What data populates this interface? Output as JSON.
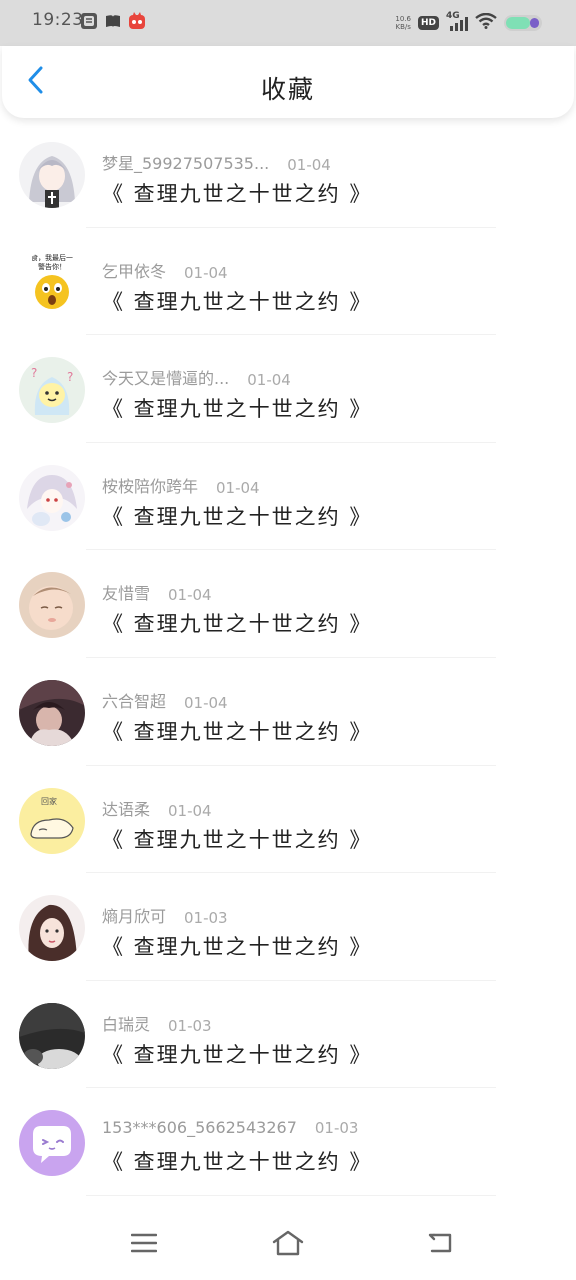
{
  "status_bar": {
    "time": "19:23",
    "net_speed_value": "10.6",
    "net_speed_unit": "KB/s",
    "hd_label": "HD",
    "network_label": "4G",
    "notification_icons": [
      "app-icon-box",
      "book-icon",
      "fox-app-icon"
    ],
    "battery_level": 0.6
  },
  "header": {
    "title": "收藏",
    "back_icon": "chevron-left-icon",
    "accent_color": "#1f8ee8"
  },
  "favorites": [
    {
      "name": "梦星_59927507535...",
      "date": "01-04",
      "content": "《 查理九世之十世之约 》"
    },
    {
      "name": "乞甲依冬",
      "date": "01-04",
      "content": "《 查理九世之十世之约 》"
    },
    {
      "name": "今天又是懵逼的...",
      "date": "01-04",
      "content": "《 查理九世之十世之约 》"
    },
    {
      "name": "桉桉陪你跨年",
      "date": "01-04",
      "content": "《 查理九世之十世之约 》"
    },
    {
      "name": "友惜雪",
      "date": "01-04",
      "content": "《 查理九世之十世之约 》"
    },
    {
      "name": "六合智超",
      "date": "01-04",
      "content": "《 查理九世之十世之约 》"
    },
    {
      "name": "达语柔",
      "date": "01-04",
      "content": "《 查理九世之十世之约 》"
    },
    {
      "name": "熵月欣可",
      "date": "01-03",
      "content": "《 查理九世之十世之约 》"
    },
    {
      "name": "白瑞灵",
      "date": "01-03",
      "content": "《 查理九世之十世之约 》"
    },
    {
      "name": "153***606_5662543267",
      "date": "01-03",
      "content": "《 查理九世之十世之约 》"
    }
  ],
  "avatar_texts": {
    "warning_line1": "食，我最后一",
    "warning_line2": "警告你！",
    "label_yellow": "回家"
  },
  "nav_bar": {
    "menu_icon": "menu-icon",
    "home_icon": "home-icon",
    "back_icon": "back-icon"
  }
}
